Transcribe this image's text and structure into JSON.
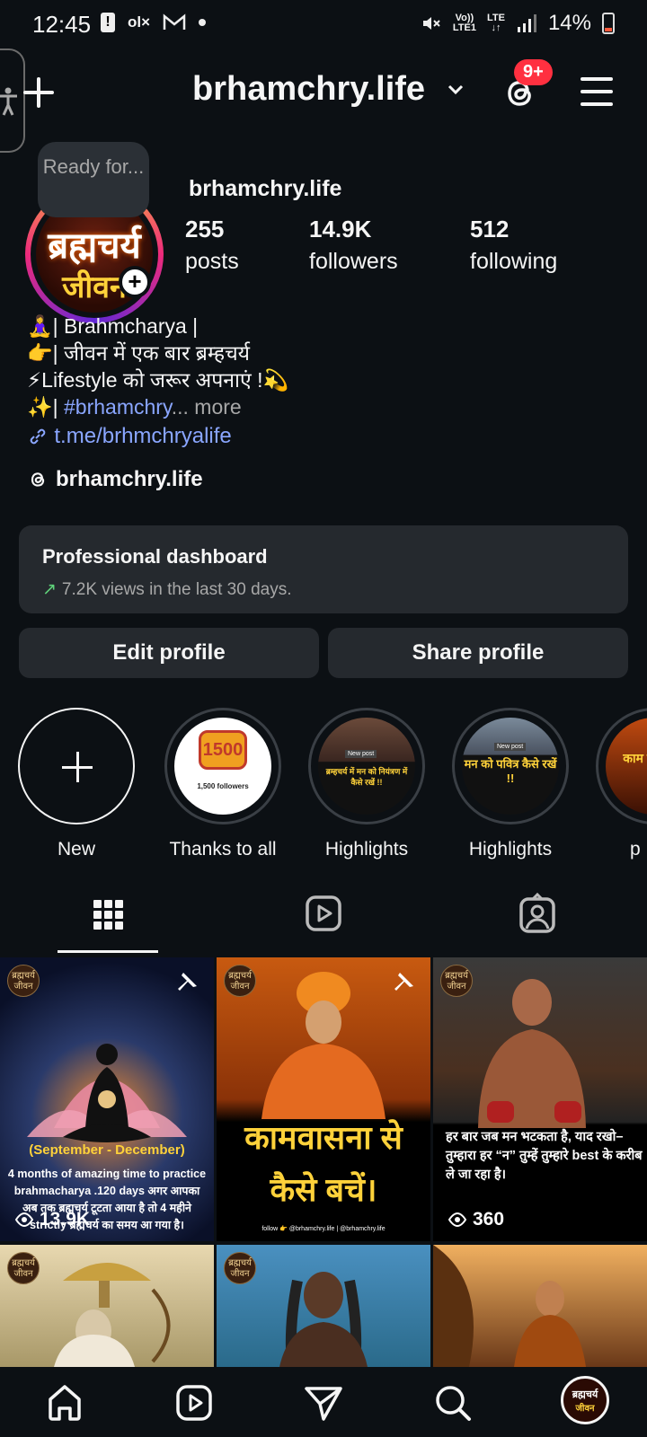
{
  "status_bar": {
    "time": "12:45",
    "left_icons": [
      "alert-icon",
      "olx-icon",
      "gmail-icon",
      "dot-icon"
    ],
    "network_top": "Vo))",
    "network_bottom": "LTE1",
    "lte_label": "LTE",
    "battery": "14%"
  },
  "header": {
    "username": "brhamchry.life",
    "notification_badge": "9+"
  },
  "tooltip": "Ready for...",
  "profile": {
    "avatar_line1": "ब्रह्मचर्य",
    "avatar_line2": "जीवन",
    "display_name": "brhamchry.life",
    "stats": [
      {
        "value": "255",
        "label": "posts"
      },
      {
        "value": "14.9K",
        "label": "followers"
      },
      {
        "value": "512",
        "label": "following"
      }
    ],
    "bio": {
      "line1": "🧘‍♀️| Brahmcharya |",
      "line2": "👉| जीवन में एक बार ब्रम्हचर्य",
      "line3": "⚡Lifestyle को जरूर अपनाएं !💫",
      "line4_prefix": "✨| ",
      "line4_tag": "#brhamchry",
      "line4_ellipsis": "...",
      "line4_more": " more",
      "link": "t.me/brhmchryalife"
    },
    "threads_handle": "brhamchry.life"
  },
  "dashboard": {
    "title": "Professional dashboard",
    "subtitle": "7.2K views in the last 30 days."
  },
  "buttons": {
    "edit": "Edit profile",
    "share": "Share profile"
  },
  "highlights": [
    {
      "label": "New",
      "image_text": ""
    },
    {
      "label": "Thanks to all",
      "image_text": "1500",
      "sub": "1,500 followers"
    },
    {
      "label": "Highlights",
      "image_text": "ब्रम्हचर्य में मन को नियंत्रण में कैसे रखें !!",
      "sub": "New post"
    },
    {
      "label": "Highlights",
      "image_text": "मन को पवित्र कैसे रखें !!",
      "sub": "New post"
    },
    {
      "label": "p",
      "image_text": "काम कै"
    }
  ],
  "grid": {
    "post1": {
      "subtitle": "(September - December)",
      "caption": "4 months of amazing time to practice brahmacharya .120 days अगर आपका अब तक ब्रह्मचर्य टूटता आया है तो 4 महीने strictly ब्रह्मचर्य का समय आ गया है।",
      "views": "13.9K"
    },
    "post2": {
      "caption": "कामवासना से कैसे बचें।",
      "footer": "follow 👉 @brhamchry.life | @brhamchry.life"
    },
    "post3": {
      "caption": "हर बार जब मन भटकता है, याद रखो– तुम्हारा हर “न” तुम्हें तुम्हारे best के करीब ले जा रहा है।",
      "views": "360"
    },
    "logo_text": "ब्रह्मचर्य जीवन"
  },
  "nav": {
    "profile_line1": "ब्रह्मचर्य",
    "profile_line2": "जीवन"
  }
}
